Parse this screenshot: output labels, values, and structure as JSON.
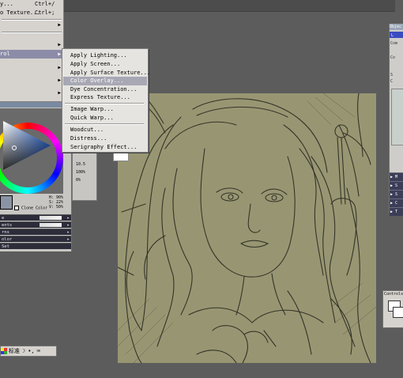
{
  "parent_menu": {
    "items": [
      {
        "label": "y...",
        "shortcut": "Ctrl+/",
        "has_arrow": false,
        "highlighted": false
      },
      {
        "label": "o Texture...",
        "shortcut": "Ctrl+;",
        "has_arrow": false,
        "highlighted": false
      },
      {
        "label": "",
        "shortcut": "",
        "has_arrow": true,
        "highlighted": false
      },
      {
        "label": "",
        "shortcut": "",
        "has_arrow": true,
        "highlighted": false
      },
      {
        "label": "rol",
        "shortcut": "",
        "has_arrow": true,
        "highlighted": true
      },
      {
        "label": "",
        "shortcut": "",
        "has_arrow": true,
        "highlighted": false
      },
      {
        "label": "",
        "shortcut": "",
        "has_arrow": true,
        "highlighted": false
      },
      {
        "label": "",
        "shortcut": "",
        "has_arrow": true,
        "highlighted": false
      }
    ]
  },
  "submenu": {
    "items": [
      {
        "label": "Apply Lighting...",
        "highlighted": false
      },
      {
        "label": "Apply Screen...",
        "highlighted": false
      },
      {
        "label": "Apply Surface Texture...",
        "highlighted": false
      },
      {
        "label": "Color Overlay...",
        "highlighted": true
      },
      {
        "label": "Dye Concentration...",
        "highlighted": false
      },
      {
        "label": "Express Texture...",
        "highlighted": false
      },
      {
        "label": "Image Warp...",
        "highlighted": false
      },
      {
        "label": "Quick Warp...",
        "highlighted": false
      },
      {
        "label": "Woodcut...",
        "highlighted": false
      },
      {
        "label": "Distress...",
        "highlighted": false
      },
      {
        "label": "Serigraphy Effect...",
        "highlighted": false
      }
    ]
  },
  "color_panel": {
    "hsv": [
      "H: 90%",
      "S: 22%",
      "V: 50%"
    ],
    "clone_label": "Clone Color",
    "current_color": "#8a94a4",
    "rows": [
      {
        "label": "e",
        "has_gradient": true
      },
      {
        "label": "ents",
        "has_gradient": true
      },
      {
        "label": "rns",
        "has_gradient": false
      },
      {
        "label": "olor",
        "has_gradient": false
      },
      {
        "label": "Set",
        "has_gradient": false
      }
    ]
  },
  "mid_panel": {
    "values": [
      "10.5",
      "100%",
      "0%"
    ]
  },
  "objects_panel": {
    "title": "Objec",
    "tab_label": "L",
    "lines": [
      "Com",
      "Co",
      "S",
      "C"
    ],
    "rows": [
      "▶ M",
      "▶ S",
      "▶ S",
      "▶ C",
      "▶ T"
    ]
  },
  "controls_panel": {
    "title": "Controls"
  },
  "ime_bar": {
    "mode_label": "标准"
  },
  "colors": {
    "canvas_bg": "#989672",
    "workspace_bg": "#5c5c5c",
    "menu_bg": "#e6e4e0",
    "menu_highlight": "#a8a8b4"
  }
}
